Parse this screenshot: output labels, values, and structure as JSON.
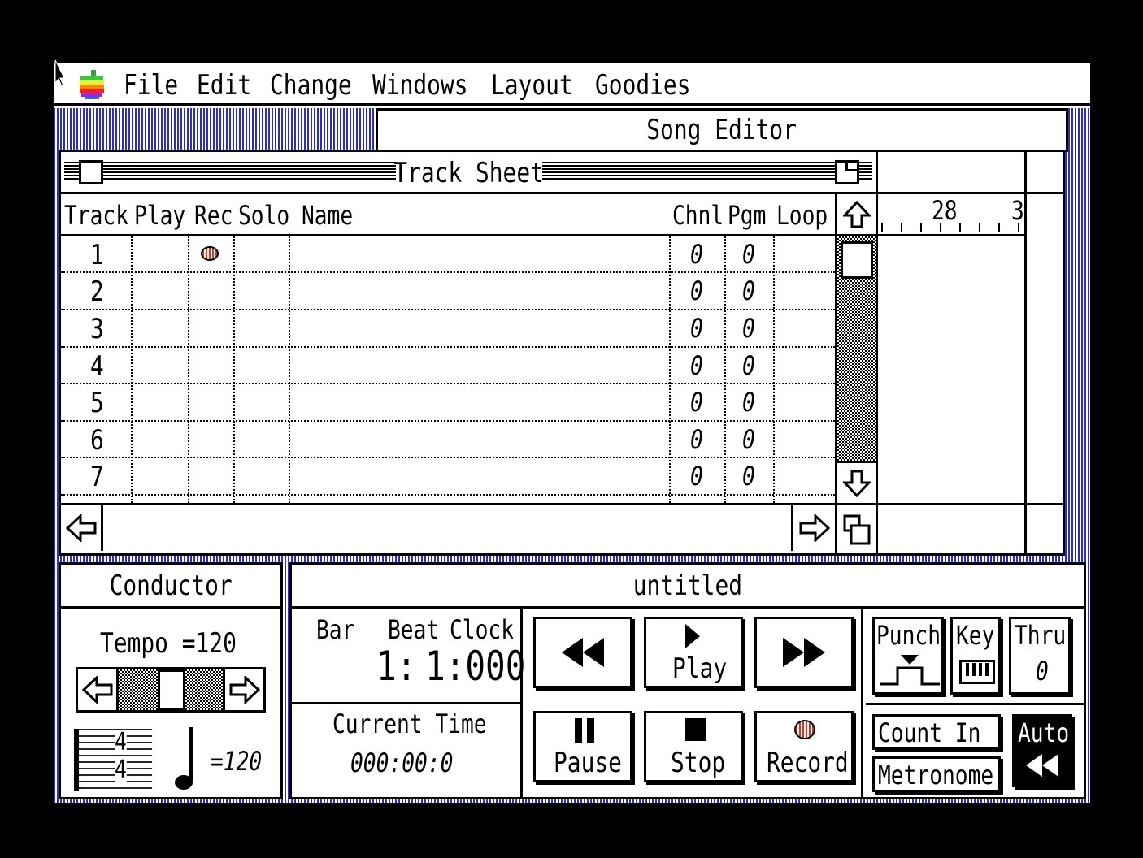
{
  "menubar": {
    "apple_icon": "apple-logo-icon",
    "items": [
      "File",
      "Edit",
      "Change",
      "Windows",
      "Layout",
      "Goodies"
    ]
  },
  "song_editor": {
    "title": "Song Editor",
    "ruler": {
      "bar_a": "28",
      "bar_b": "3"
    }
  },
  "track_sheet": {
    "title": "Track Sheet",
    "columns": [
      "Track",
      "Play",
      "Rec",
      "Solo",
      "Name",
      "Chnl",
      "Pgm",
      "Loop"
    ],
    "rows": [
      {
        "track": "1",
        "rec": true,
        "chnl": "0",
        "pgm": "0"
      },
      {
        "track": "2",
        "rec": false,
        "chnl": "0",
        "pgm": "0"
      },
      {
        "track": "3",
        "rec": false,
        "chnl": "0",
        "pgm": "0"
      },
      {
        "track": "4",
        "rec": false,
        "chnl": "0",
        "pgm": "0"
      },
      {
        "track": "5",
        "rec": false,
        "chnl": "0",
        "pgm": "0"
      },
      {
        "track": "6",
        "rec": false,
        "chnl": "0",
        "pgm": "0"
      },
      {
        "track": "7",
        "rec": false,
        "chnl": "0",
        "pgm": "0"
      }
    ]
  },
  "conductor": {
    "title": "Conductor",
    "tempo_label": "Tempo =120",
    "time_signature_top": "4",
    "time_signature_bottom": "4",
    "note_tempo": "=120"
  },
  "transport": {
    "title": "untitled",
    "counter": {
      "bar_label": "Bar",
      "beat_label": "Beat",
      "clock_label": "Clock",
      "bar": "1:",
      "beat_clock": "1:000"
    },
    "current_time_label": "Current Time",
    "current_time": "000:00:0",
    "buttons": {
      "play": "Play",
      "pause": "Pause",
      "stop": "Stop",
      "record": "Record"
    },
    "options": {
      "punch": "Punch",
      "key": "Key",
      "thru": "Thru",
      "thru_value": "0",
      "count_in": "Count In",
      "metronome": "Metronome",
      "auto": "Auto"
    }
  },
  "colors": {
    "desktop_stripe": "#2b2bd6",
    "record_red": "#e0321e"
  }
}
